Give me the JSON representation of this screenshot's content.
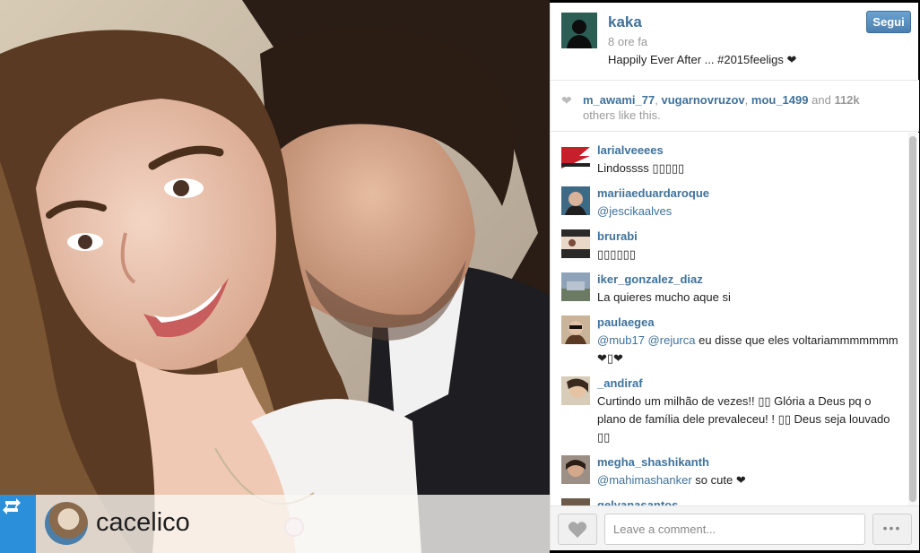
{
  "post": {
    "owner": "kaka",
    "time": "8 ore fa",
    "caption": "Happily Ever After ... #2015feeligs ❤",
    "follow_label": "Segui"
  },
  "repost": {
    "username": "cacelico"
  },
  "likes": {
    "users": [
      "m_awami_77",
      "vugarnovruzov",
      "mou_1499"
    ],
    "and": "and",
    "count": "112k",
    "suffix": "others like this."
  },
  "comments": [
    {
      "user": "larialveeees",
      "text": "Lindossss ▯▯▯▯▯"
    },
    {
      "user": "mariiaeduardaroque",
      "mention": "@jescikaalves",
      "text": ""
    },
    {
      "user": "brurabi",
      "text": "▯▯▯▯▯▯"
    },
    {
      "user": "iker_gonzalez_diaz",
      "text": "La quieres mucho aque si"
    },
    {
      "user": "paulaegea",
      "mention": "@mub17 @rejurca",
      "text": " eu disse que eles voltariammmmmmm ❤▯❤"
    },
    {
      "user": "_andiraf",
      "text": "Curtindo um milhão de vezes!! ▯▯ Glória a Deus pq o plano de família dele prevaleceu! ! ▯▯ Deus seja louvado ▯▯"
    },
    {
      "user": "megha_shashikanth",
      "mention": "@mahimashanker",
      "text": " so cute ❤"
    },
    {
      "user": "gelyanasantos",
      "text": ""
    }
  ],
  "footer": {
    "comment_placeholder": "Leave a comment...",
    "more_label": "•••"
  },
  "icons": {
    "repost": "repost-icon",
    "like": "heart-icon",
    "likes_heart": "heart-icon",
    "more": "ellipsis-icon"
  },
  "colors": {
    "link_blue": "#3f729b",
    "repost_blue": "#2b8fd9",
    "follow_button": "#4a7fb0"
  }
}
